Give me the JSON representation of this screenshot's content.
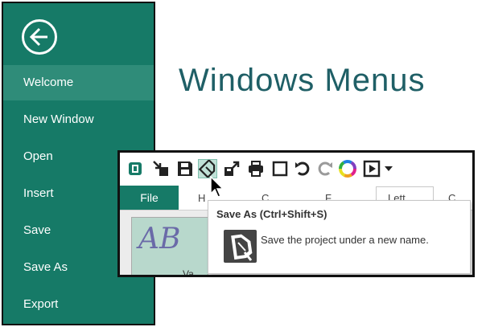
{
  "sidebar": {
    "items": [
      {
        "label": "Welcome",
        "active": true
      },
      {
        "label": "New Window",
        "active": false
      },
      {
        "label": "Open",
        "active": false
      },
      {
        "label": "Insert",
        "active": false
      },
      {
        "label": "Save",
        "active": false
      },
      {
        "label": "Save As",
        "active": false
      },
      {
        "label": "Export",
        "active": false
      }
    ]
  },
  "main": {
    "title": "Windows Menus"
  },
  "app": {
    "toolbar_icons": [
      "app-icon",
      "insert-icon",
      "save-icon",
      "save-as-icon",
      "export-icon",
      "print-icon",
      "new-window-icon",
      "undo-icon",
      "redo-icon",
      "color-wheel-icon",
      "play-icon",
      "customize-dropdown-icon"
    ],
    "ribbon": {
      "file_tab": "File",
      "tabs": [
        "H",
        "C",
        "F",
        "Lett",
        "C"
      ]
    },
    "thumbnail": {
      "text": "AB",
      "label": "Va"
    }
  },
  "tooltip": {
    "title": "Save As (Ctrl+Shift+S)",
    "description": "Save the project under a new name."
  },
  "colors": {
    "sidebar_bg": "#167a67",
    "sidebar_active": "#2f8c79",
    "title_color": "#1f5f66",
    "file_tab_bg": "#167a67"
  }
}
